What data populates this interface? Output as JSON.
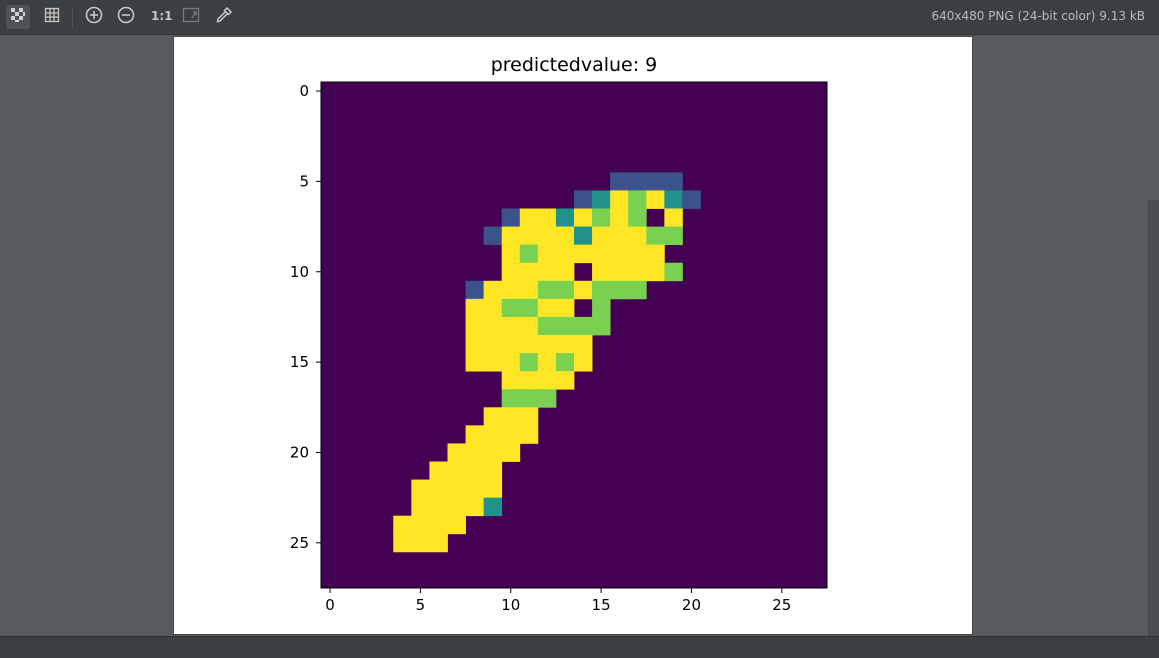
{
  "toolbar": {
    "buttons": [
      {
        "name": "chessboard-toggle-button",
        "icon": "chessboard-icon",
        "active": true
      },
      {
        "name": "grid-toggle-button",
        "icon": "grid-icon",
        "active": false
      },
      {
        "name": "zoom-in-button",
        "icon": "zoom-in-icon",
        "active": false
      },
      {
        "name": "zoom-out-button",
        "icon": "zoom-out-icon",
        "active": false
      },
      {
        "name": "actual-size-button",
        "icon": "one-to-one-icon",
        "active": false
      },
      {
        "name": "fit-zoom-button",
        "icon": "fit-icon",
        "active": false
      },
      {
        "name": "color-picker-button",
        "icon": "eyedropper-icon",
        "active": false
      }
    ],
    "actual_size_label": "1:1"
  },
  "file_info": "640x480 PNG (24-bit color) 9.13 kB",
  "chart_data": {
    "type": "heatmap",
    "title": "predictedvalue: 9",
    "colormap": "viridis",
    "xlim": [
      -0.5,
      27.5
    ],
    "ylim": [
      27.5,
      -0.5
    ],
    "x_ticks": [
      0,
      5,
      10,
      15,
      20,
      25
    ],
    "y_ticks": [
      0,
      5,
      10,
      15,
      20,
      25
    ],
    "x_tick_labels": [
      "0",
      "5",
      "10",
      "15",
      "20",
      "25"
    ],
    "y_tick_labels": [
      "0",
      "5",
      "10",
      "15",
      "20",
      "25"
    ],
    "rows_start": 5,
    "rows": [
      "................2222..........",
      "..............2345432.........",
      "..........24434545.4..........",
      ".........24444344455..........",
      "..........454444444...........",
      "..........4444.44445..........",
      "........2444554555............",
      "........445544.5..............",
      "........44445555..............",
      "........4444444...............",
      "........4445454...............",
      "..........4444................",
      "..........555.................",
      ".........444..................",
      "........4444..................",
      ".......4444...................",
      "......4444....................",
      ".....44444....................",
      ".....44443....................",
      "....4444......................",
      "....444......................."
    ]
  }
}
